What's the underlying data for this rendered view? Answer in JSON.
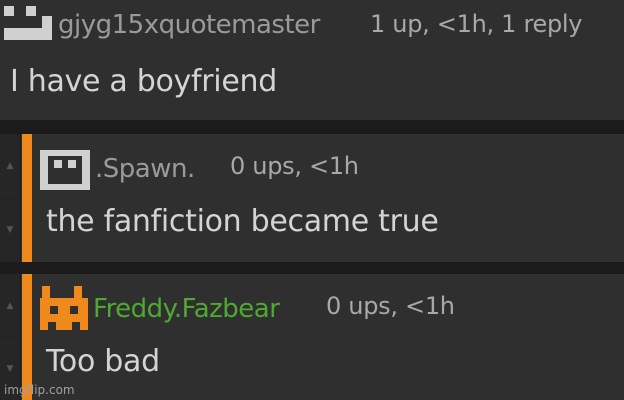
{
  "comments": [
    {
      "username": "gjyg15xquotemaster",
      "meta": "1 up, <1h, 1 reply",
      "text": "I have a boyfriend",
      "username_color": "#9a9a9a",
      "avatar_icon": "square-face-icon"
    },
    {
      "username": ".Spawn.",
      "meta": "0 ups, <1h",
      "text": "the fanfiction became true",
      "username_color": "#9a9a9a",
      "avatar_icon": "pixel-face-icon"
    },
    {
      "username": "Freddy.Fazbear",
      "meta": "0 ups, <1h",
      "text": "Too bad",
      "username_color": "#4fa832",
      "avatar_icon": "orange-bear-icon"
    }
  ],
  "colors": {
    "accent_bar": "#f0891c",
    "background": "#2f2f2f",
    "divider": "#1b1b1b"
  },
  "watermark": "imgflip.com"
}
